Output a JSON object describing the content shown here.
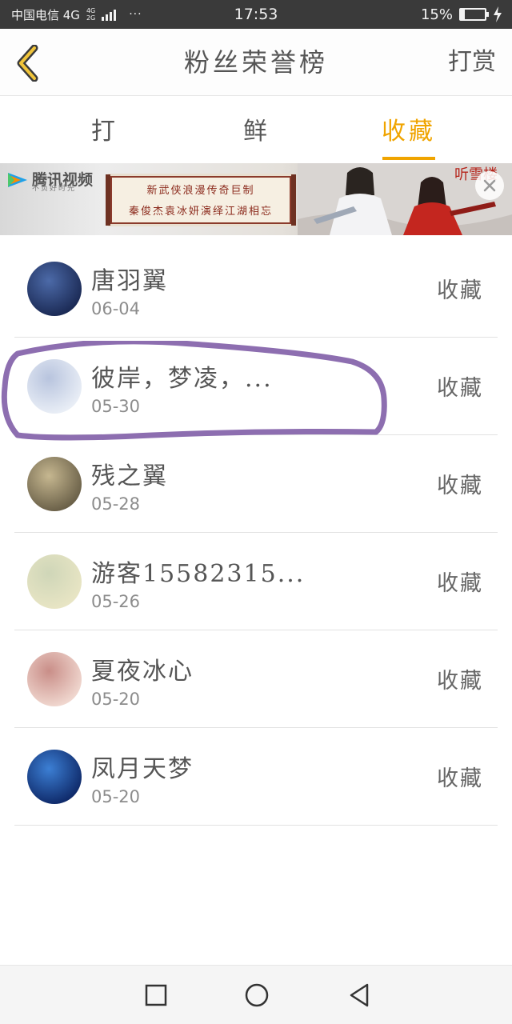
{
  "status_bar": {
    "carrier": "中国电信 4G",
    "network_top": "4G",
    "network_bottom": "2G",
    "dots": "···",
    "time": "17:53",
    "battery_text": "15%",
    "battery_level": 0.15
  },
  "header": {
    "back_icon": "chevron-left-icon",
    "title": "粉丝荣誉榜",
    "action_label": "打赏"
  },
  "tabs": [
    {
      "label": "打赏",
      "active": false
    },
    {
      "label": "鲜花",
      "active": false
    },
    {
      "label": "收藏",
      "active": true
    }
  ],
  "banner": {
    "logo_text": "腾讯视频",
    "logo_sub": "不负好时光",
    "line1": "新武侠浪漫传奇巨制",
    "line2": "秦俊杰袁冰妍演绎江湖相忘",
    "corner_text": "听雪楼",
    "close_icon": "close-icon"
  },
  "fans": [
    {
      "name": "唐羽翼",
      "date": "06-04",
      "type": "收藏",
      "avatar_colors": [
        "#1b2a55",
        "#4c6aa8"
      ]
    },
    {
      "name": "彼岸，梦凌，...",
      "date": "05-30",
      "type": "收藏",
      "avatar_colors": [
        "#e9eef6",
        "#b8c4de"
      ]
    },
    {
      "name": "残之翼",
      "date": "05-28",
      "type": "收藏",
      "avatar_colors": [
        "#6a6048",
        "#c6b790"
      ]
    },
    {
      "name": "游客15582315...",
      "date": "05-26",
      "type": "收藏",
      "avatar_colors": [
        "#e8e5c4",
        "#cfd6b8"
      ]
    },
    {
      "name": "夏夜冰心",
      "date": "05-20",
      "type": "收藏",
      "avatar_colors": [
        "#f0d7cf",
        "#c98e88"
      ]
    },
    {
      "name": "凤月天梦",
      "date": "05-20",
      "type": "收藏",
      "avatar_colors": [
        "#0f2a6a",
        "#3c7fd4"
      ]
    }
  ],
  "colors": {
    "accent": "#f0a400",
    "annotation": "#8d6eb0",
    "status_bar": "#3a3a3a"
  },
  "nav": {
    "recent_icon": "square-icon",
    "home_icon": "circle-icon",
    "back_icon": "triangle-back-icon"
  }
}
